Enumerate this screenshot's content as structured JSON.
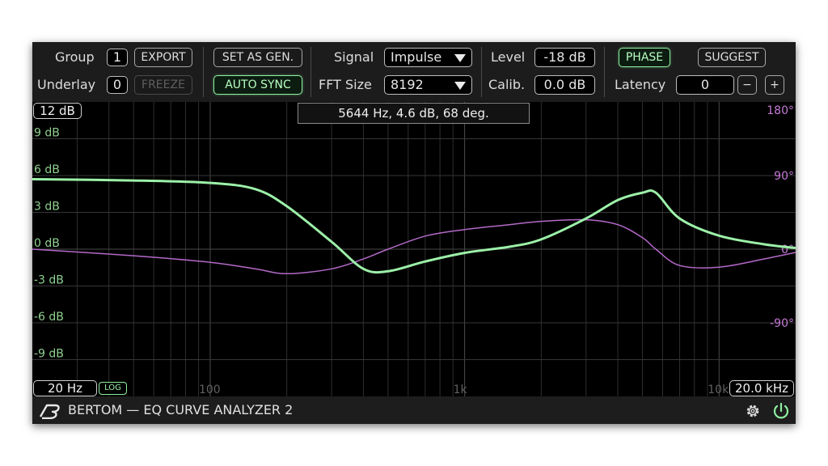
{
  "app": {
    "brand": "BERTOM",
    "title": "BERTOM — EQ CURVE ANALYZER 2"
  },
  "toolbar": {
    "group_label": "Group",
    "group_value": "1",
    "underlay_label": "Underlay",
    "underlay_value": "0",
    "export_label": "EXPORT",
    "freeze_label": "FREEZE",
    "set_as_gen_label": "SET AS GEN.",
    "auto_sync_label": "AUTO SYNC",
    "signal_label": "Signal",
    "signal_value": "Impulse",
    "fft_label": "FFT Size",
    "fft_value": "8192",
    "level_label": "Level",
    "level_value": "-18 dB",
    "calib_label": "Calib.",
    "calib_value": "0.0 dB",
    "phase_label": "PHASE",
    "suggest_label": "SUGGEST",
    "latency_label": "Latency",
    "latency_value": "0",
    "minus_label": "−",
    "plus_label": "+"
  },
  "graph": {
    "range_top": "12 dB",
    "y_labels": [
      "9 dB",
      "6 dB",
      "3 dB",
      "0 dB",
      "-3 dB",
      "-6 dB",
      "-9 dB"
    ],
    "phase_labels": [
      "180°",
      "90°",
      "0°",
      "-90°"
    ],
    "x_labels": [
      "100",
      "1k",
      "10k"
    ],
    "freq_min": "20 Hz",
    "freq_max": "20.0 kHz",
    "log_label": "LOG",
    "tooltip": "5644 Hz, 4.6 dB, 68 deg."
  },
  "chart_data": {
    "type": "line",
    "x_scale": "log",
    "xlim": [
      20,
      20000
    ],
    "ylim": [
      -12,
      12
    ],
    "phase_lim": [
      -180,
      180
    ],
    "series": [
      {
        "color": "#9cf0a8",
        "axis": "magnitude_dB",
        "x": [
          20,
          50,
          100,
          150,
          200,
          300,
          400,
          500,
          700,
          1000,
          1500,
          2000,
          3000,
          4000,
          5000,
          5644,
          7000,
          10000,
          15000,
          20000
        ],
        "y": [
          5.7,
          5.6,
          5.4,
          4.9,
          3.5,
          0.6,
          -1.6,
          -1.8,
          -1.0,
          -0.3,
          0.2,
          0.8,
          2.5,
          4.0,
          4.6,
          4.6,
          2.5,
          1.1,
          0.4,
          0.1
        ]
      },
      {
        "color": "#b469c8",
        "axis": "phase_deg",
        "x": [
          20,
          50,
          100,
          150,
          200,
          300,
          400,
          500,
          700,
          1000,
          1500,
          2000,
          3000,
          4000,
          5000,
          5644,
          7000,
          10000,
          15000,
          20000
        ],
        "y": [
          0,
          -8,
          -16,
          -24,
          -30,
          -24,
          -12,
          0,
          16,
          24,
          30,
          34,
          36,
          30,
          14,
          0,
          -20,
          -22,
          -12,
          -4
        ]
      }
    ]
  },
  "footer": {
    "settings_icon": "gear-icon",
    "power_icon": "power-icon"
  },
  "colors": {
    "accent": "#8ef0a0",
    "phase": "#b469c8",
    "db_label": "#8fd08f",
    "phase_label": "#c57bd6"
  }
}
